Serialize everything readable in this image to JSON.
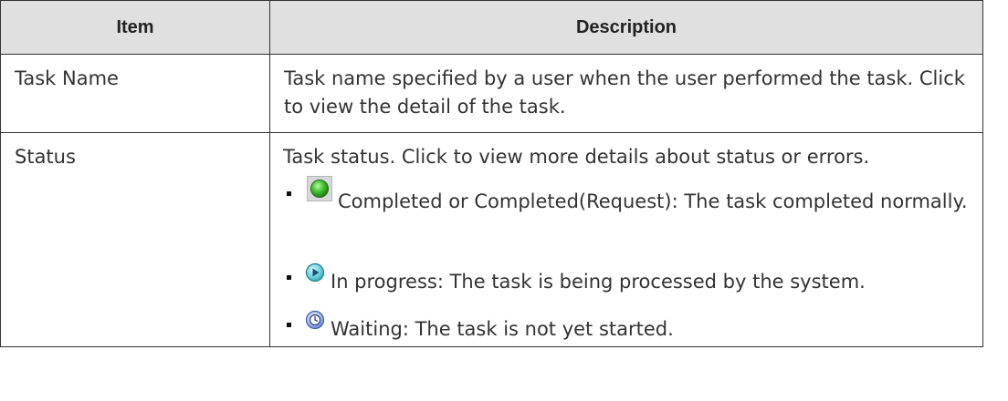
{
  "table": {
    "headers": {
      "item": "Item",
      "description": "Description"
    },
    "rows": {
      "task_name": {
        "item": "Task Name",
        "description": "Task name specified by a user when the user performed the task. Click to view the detail of the task."
      },
      "status": {
        "item": "Status",
        "description": "Task status. Click to view more details about status or errors.",
        "statuses": [
          {
            "icon": "completed-green-circle-icon",
            "text": "Completed or Completed(Request): The task completed normally."
          },
          {
            "icon": "in-progress-play-icon",
            "text": "In progress: The task is being processed by the system."
          },
          {
            "icon": "waiting-clock-icon",
            "text": "Waiting: The task is not yet started."
          }
        ]
      }
    }
  },
  "colors": {
    "header_bg": "#e0e0e0",
    "border": "#333333",
    "completed_green": "#3dbf2a",
    "progress_teal": "#2aa7b8",
    "waiting_blue": "#5a7fd6"
  }
}
